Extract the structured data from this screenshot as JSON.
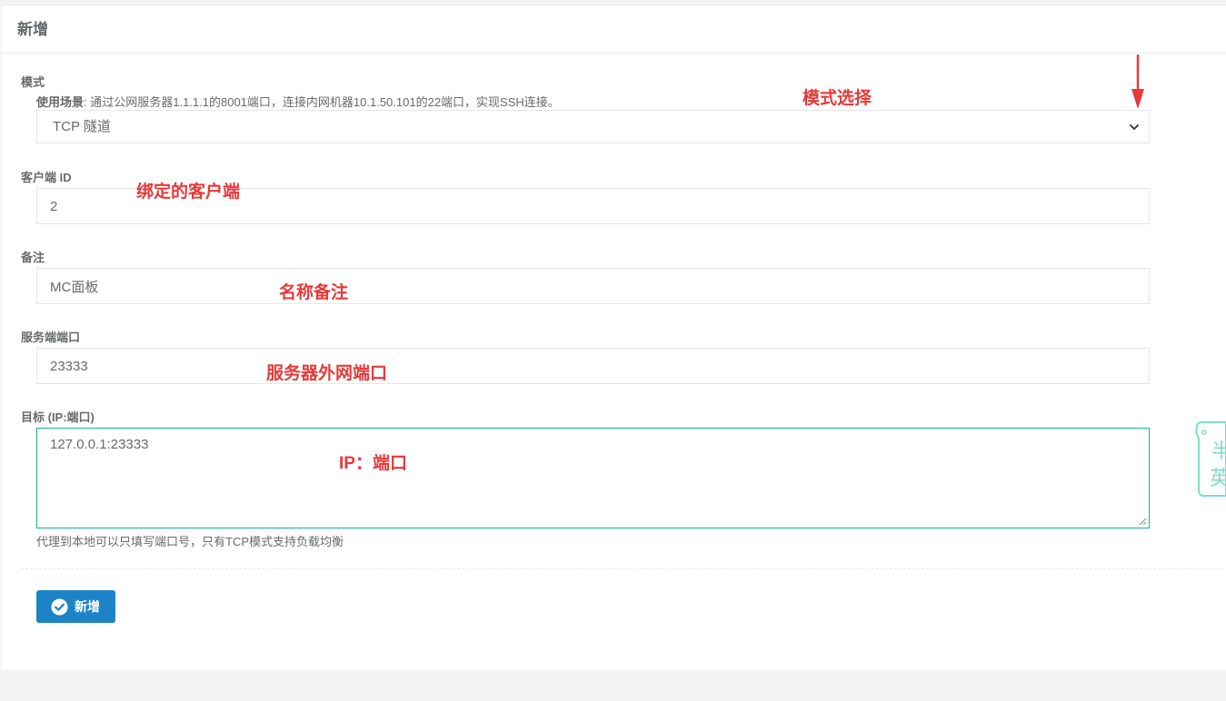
{
  "panel": {
    "title": "新增"
  },
  "mode": {
    "label": "模式",
    "scene_label": "使用场景",
    "scene_text": ": 通过公网服务器1.1.1.1的8001端口，连接内网机器10.1.50.101的22端口，实现SSH连接。",
    "selected": "TCP 隧道"
  },
  "client": {
    "label": "客户端 ID",
    "value": "2"
  },
  "remark": {
    "label": "备注",
    "value": "MC面板"
  },
  "server_port": {
    "label": "服务端端口",
    "value": "23333"
  },
  "target": {
    "label": "目标 (IP:端口)",
    "value": "127.0.0.1:23333",
    "help": "代理到本地可以只填写端口号，只有TCP模式支持负载均衡"
  },
  "submit": {
    "label": "新增"
  },
  "annotations": {
    "mode": "模式选择",
    "client": "绑定的客户端",
    "remark": "名称备注",
    "server_port": "服务器外网端口",
    "target": "IP：端口"
  },
  "sticker": {
    "line1": "半",
    "line2": "英"
  },
  "colors": {
    "accent_green": "#1ab394",
    "button_blue": "#1c84c6",
    "annotation_red": "#e8393a"
  }
}
